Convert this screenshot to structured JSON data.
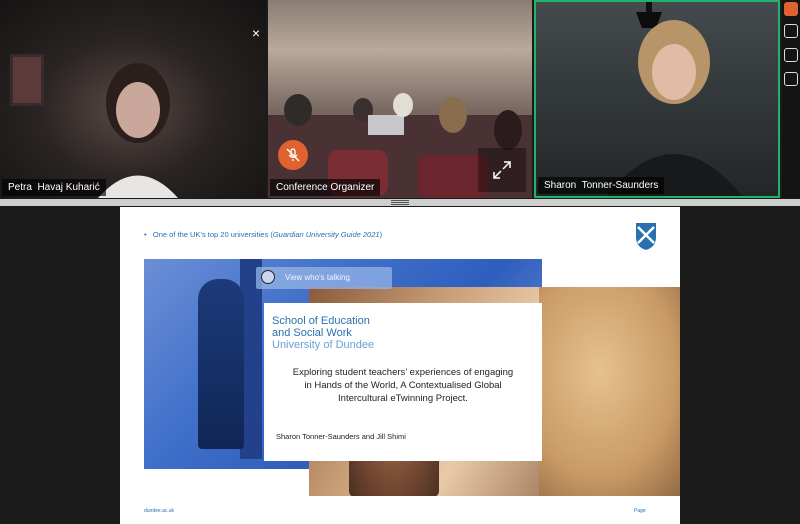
{
  "participants": [
    {
      "name": "Petra  Havaj Kuharić"
    },
    {
      "name": "Conference Organizer"
    },
    {
      "name": "Sharon  Tonner-Saunders"
    }
  ],
  "controls": {
    "close_glyph": "×",
    "mic_icon": "mic-muted-icon",
    "expand_icon": "expand-icon"
  },
  "colors": {
    "active_speaker_border": "#21b36a",
    "muted_mic": "#e0622f",
    "brand_blue": "#2a6fb0"
  },
  "slide": {
    "bullet_prefix": "One of the UK’s top 20 universities (",
    "bullet_italic": "Guardian University Guide 2021",
    "bullet_suffix": ")",
    "school_line1": "School of Education",
    "school_line2": "and Social Work",
    "school_line3": "University of Dundee",
    "title_line1": "Exploring student teachers’ experiences of engaging",
    "title_line2": "in Hands of the World, A Contextualised Global",
    "title_line3": "Intercultural eTwinning Project.",
    "authors": "Sharon Tonner-Saunders and Jill Shimi",
    "footer_url": "dundee.ac.uk",
    "footer_page": "Page"
  },
  "view_talking": "View who's talking"
}
